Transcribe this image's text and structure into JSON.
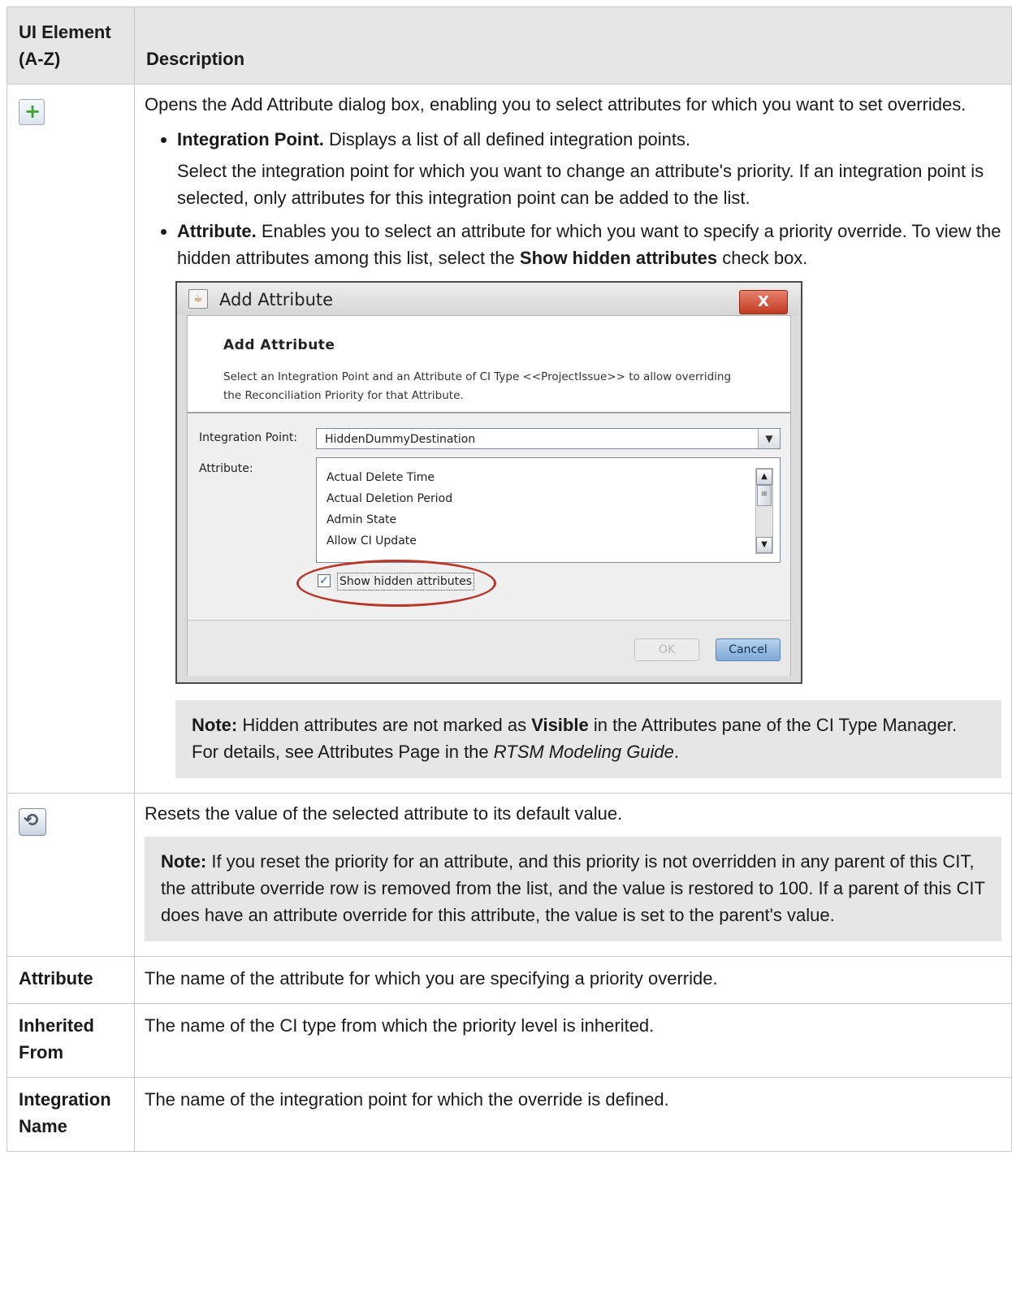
{
  "table": {
    "header_col1": "UI Element (A-Z)",
    "header_col2": "Description"
  },
  "row_add": {
    "icon": "green-plus-icon",
    "intro": "Opens the Add Attribute dialog box, enabling you to select attributes for which you want to set overrides.",
    "bullet1_bold": "Integration Point.",
    "bullet1_text": " Displays a list of all defined integration points.",
    "bullet1_sub": "Select the integration point for which you want to change an attribute's priority. If an integration point is selected, only attributes for this integration point can be added to the list.",
    "bullet2_bold": "Attribute.",
    "bullet2_text1": " Enables you to select an attribute for which you want to specify a priority override. To view the hidden attributes among this list, select the ",
    "bullet2_bold2": "Show hidden attributes",
    "bullet2_text2": " check box.",
    "note_bold": "Note:",
    "note_text1": " Hidden attributes are not marked as ",
    "note_bold2": "Visible",
    "note_text2": " in the Attributes pane of the CI Type Manager. For details, see Attributes Page in the ",
    "note_italic": "RTSM Modeling Guide",
    "note_text3": "."
  },
  "dialog": {
    "window_title": "Add Attribute",
    "close_label": "X",
    "heading": "Add Attribute",
    "description": "Select an Integration Point and an Attribute of CI Type <<ProjectIssue>> to allow overriding the Reconciliation Priority for that Attribute.",
    "integration_point_label": "Integration Point:",
    "integration_point_value": "HiddenDummyDestination",
    "attribute_label": "Attribute:",
    "attributes": [
      "Actual Delete Time",
      "Actual Deletion Period",
      "Admin State",
      "Allow CI Update"
    ],
    "show_hidden_label": "Show hidden attributes",
    "show_hidden_checked": true,
    "ok_label": "OK",
    "cancel_label": "Cancel"
  },
  "row_reset": {
    "icon": "reset-icon",
    "text": "Resets the value of the selected attribute to its default value.",
    "note_bold": "Note:",
    "note_text": " If you reset the priority for an attribute, and this priority is not overridden in any parent of this CIT, the attribute override row is removed from the list, and the value is restored to 100. If a parent of this CIT does have an attribute override for this attribute, the value is set to the parent's value."
  },
  "rows": [
    {
      "element": "Attribute",
      "description": "The name of the attribute for which you are specifying a priority override."
    },
    {
      "element": "Inherited From",
      "description": "The name of the CI type from which the priority level is inherited."
    },
    {
      "element": "Integration Name",
      "description": "The name of the integration point for which the override is defined."
    }
  ]
}
